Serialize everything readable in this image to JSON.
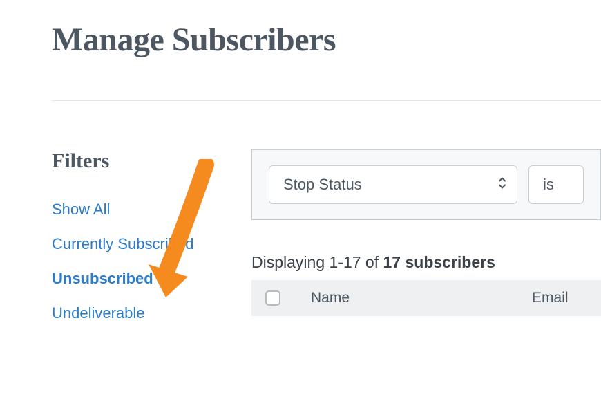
{
  "page": {
    "title": "Manage Subscribers"
  },
  "sidebar": {
    "heading": "Filters",
    "items": [
      {
        "label": "Show All",
        "active": false
      },
      {
        "label": "Currently Subscribed",
        "active": false
      },
      {
        "label": "Unsubscribed",
        "active": true
      },
      {
        "label": "Undeliverable",
        "active": false
      }
    ]
  },
  "filterBar": {
    "select1": "Stop Status",
    "select2": "is"
  },
  "results": {
    "prefix": "Displaying 1-17 of ",
    "bold": "17 subscribers"
  },
  "table": {
    "columns": [
      "Name",
      "Email"
    ]
  }
}
